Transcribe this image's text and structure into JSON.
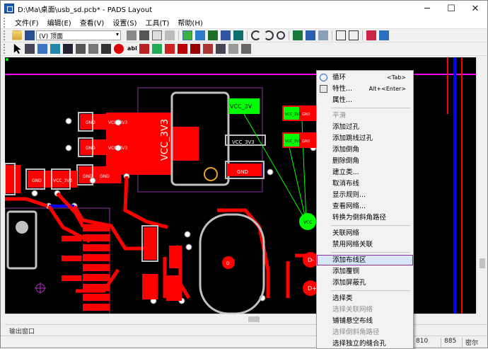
{
  "window": {
    "title": "D:\\Ma\\桌面\\usb_sd.pcb* - PADS Layout",
    "minimize_glyph": "─",
    "maximize_glyph": "☐",
    "close_glyph": "✕"
  },
  "menubar": {
    "items": [
      "文件(F)",
      "编辑(E)",
      "查看(V)",
      "设置(S)",
      "工具(T)",
      "帮助(H)"
    ]
  },
  "toolbar": {
    "layer_value": "(V) 顶面",
    "layer_chevron": "▾"
  },
  "canvas": {
    "labels": {
      "gnd_a": "GND",
      "vcc_a": "VCC_3V3",
      "gnd_b": "GND",
      "vcc_b": "VCC_3V3",
      "gnd_c": "GND",
      "gnd_d": "GND",
      "vcc_c": "VCC_3V3",
      "gnd_e": "GND",
      "vcc_big": "VCC_3V3",
      "vcc_mid": "VCC_3V3",
      "gnd_f": "GND",
      "vcc_green": "VCC_3V",
      "vcc_g1": "VCC_3V3",
      "gnd_g1": "GND",
      "vcc_g2": "VCC_3V3",
      "gnd_g2": "GND",
      "vcc_round": "VCC",
      "d_small": "D",
      "via_e": "E",
      "d_big1": "D-",
      "d_big2": "D+"
    }
  },
  "context_menu": {
    "items": [
      {
        "label": "循环",
        "accel": "<Tab>",
        "enabled": true,
        "icon": "cycle-icon"
      },
      {
        "label": "特性...",
        "accel": "Alt+<Enter>",
        "enabled": true,
        "icon": "properties-icon"
      },
      {
        "label": "属性...",
        "accel": "",
        "enabled": true
      },
      {
        "label": "平滑",
        "accel": "",
        "enabled": false
      },
      {
        "label": "添加过孔",
        "accel": "",
        "enabled": true
      },
      {
        "label": "添加跳线过孔",
        "accel": "",
        "enabled": true
      },
      {
        "label": "添加倒角",
        "accel": "",
        "enabled": true
      },
      {
        "label": "删除倒角",
        "accel": "",
        "enabled": true
      },
      {
        "label": "建立类...",
        "accel": "",
        "enabled": true
      },
      {
        "label": "取消布线",
        "accel": "",
        "enabled": true
      },
      {
        "label": "显示规则...",
        "accel": "",
        "enabled": true
      },
      {
        "label": "查看网络...",
        "accel": "",
        "enabled": true
      },
      {
        "label": "转换为倒斜角路径",
        "accel": "",
        "enabled": true
      },
      {
        "label": "关联网络",
        "accel": "",
        "enabled": true
      },
      {
        "label": "禁用网络关联",
        "accel": "",
        "enabled": true
      },
      {
        "label": "添加布线区",
        "accel": "",
        "enabled": true,
        "highlighted": true
      },
      {
        "label": "添加覆铜",
        "accel": "",
        "enabled": true
      },
      {
        "label": "添加屏蔽孔",
        "accel": "",
        "enabled": true
      },
      {
        "label": "选择类",
        "accel": "",
        "enabled": true
      },
      {
        "label": "选择关联网络",
        "accel": "",
        "enabled": false
      },
      {
        "label": "铺铺悬空布线",
        "accel": "",
        "enabled": true
      },
      {
        "label": "选择倒斜角路径",
        "accel": "",
        "enabled": false
      },
      {
        "label": "选择独立的缝合孔",
        "accel": "",
        "enabled": true
      }
    ]
  },
  "output_window": {
    "label": "输出窗口"
  },
  "status": {
    "x": "810",
    "y": "885",
    "unit": "密尔"
  },
  "colors": {
    "copper_red": "#ff0000",
    "pad_gray": "#c0c0c0",
    "net_green": "#00ff00",
    "board_magenta": "#ff00ff",
    "outline_purple": "#8b2fa3",
    "blue_trace": "#0000ff",
    "highlight_border": "#8b2fa3"
  }
}
